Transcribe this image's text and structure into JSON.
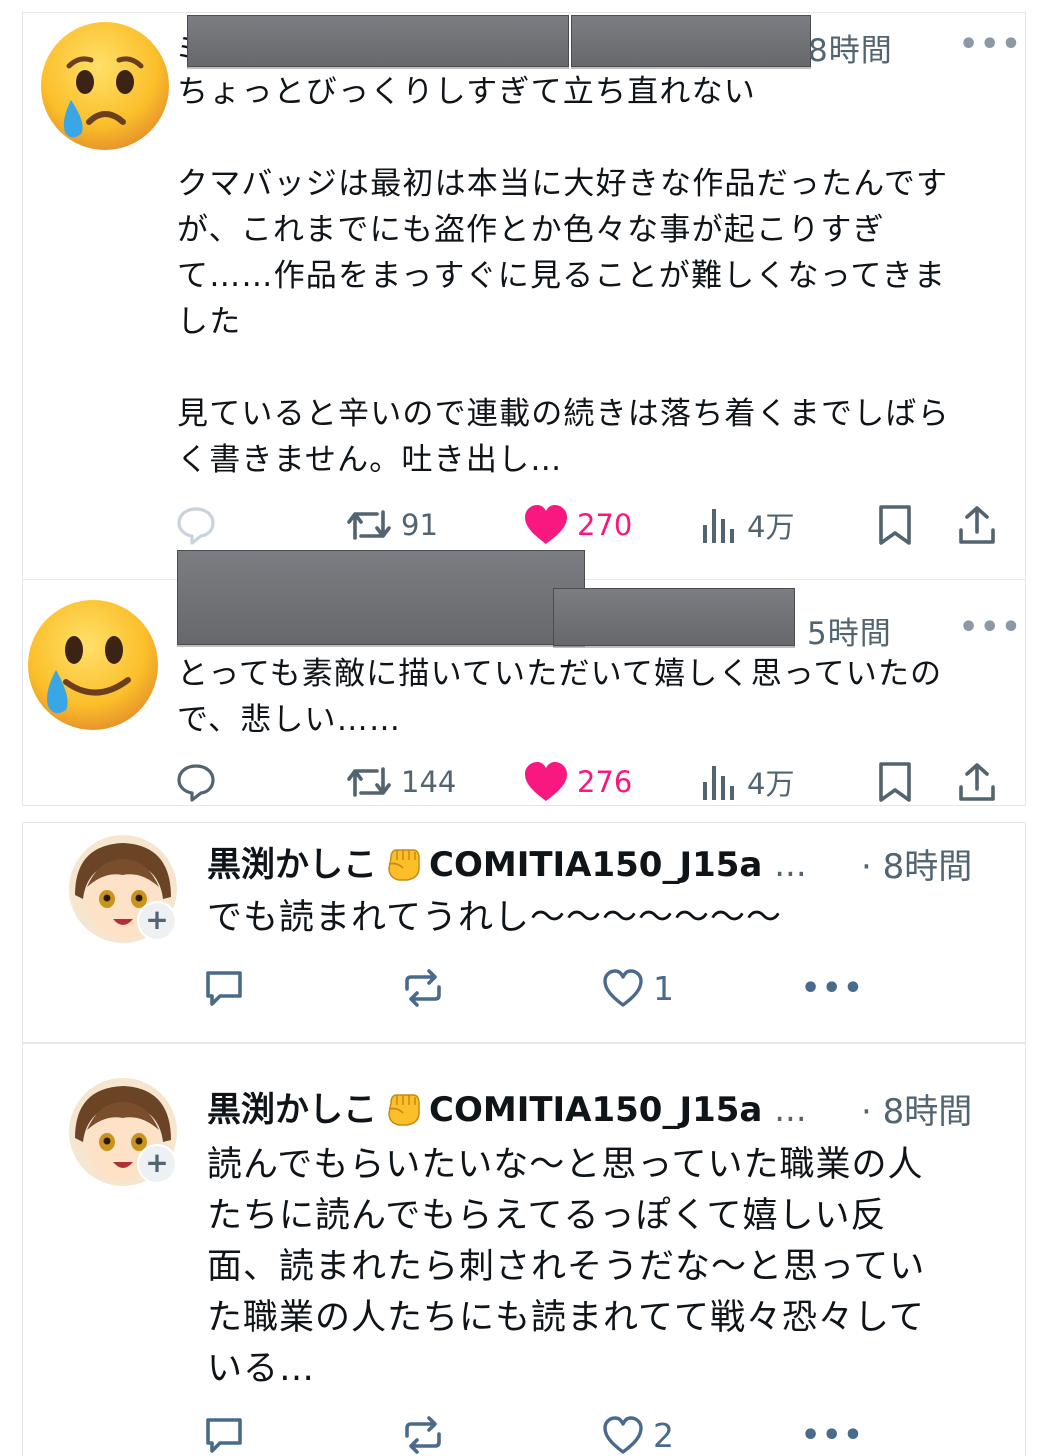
{
  "tweets": [
    {
      "name_initial": "ミ",
      "time": "8時間",
      "more": "•••",
      "emoji": "crying-face",
      "text": "ちょっとびっくりしすぎて立ち直れない\n\nクマバッジは最初は本当に大好きな作品だったんです\nが、これまでにも盗作とか色々な事が起こりすぎ\nて……作品をまっすぐに見ることが難しくなってきま\nした\n\n見ていると辛いので連載の続きは落ち着くまでしばら\nく書きません。吐き出し…",
      "retweets": "91",
      "likes": "270",
      "views": "4万",
      "liked": true
    },
    {
      "time": "5時間",
      "more": "•••",
      "emoji": "smiling-face-with-tear",
      "text": "とっても素敵に描いていただいて嬉しく思っていたの\nで、悲しい……",
      "retweets": "144",
      "likes": "276",
      "views": "4万",
      "liked": true
    }
  ],
  "replies": [
    {
      "name": "黒渕かしこ",
      "handle": "COMITIA150_J15a",
      "ellipsis": "...",
      "time": "· 8時間",
      "text": "でも読まれてうれし〜〜〜〜〜〜〜",
      "likes": "1",
      "more": "•••"
    },
    {
      "name": "黒渕かしこ",
      "handle": "COMITIA150_J15a",
      "ellipsis": "...",
      "time": "· 8時間",
      "text": "読んでもらいたいな〜と思っていた職業の人\nたちに読んでもらえてるっぽくて嬉しい反\n面、読まれたら刺されそうだな〜と思ってい\nた職業の人たちにも読まれてて戦々恐々して\nいる…",
      "likes": "2",
      "more": "•••"
    }
  ],
  "colors": {
    "like": "#f91880",
    "muted": "#536471",
    "text": "#0f1419",
    "reply_icon": "#4a6a8c"
  }
}
